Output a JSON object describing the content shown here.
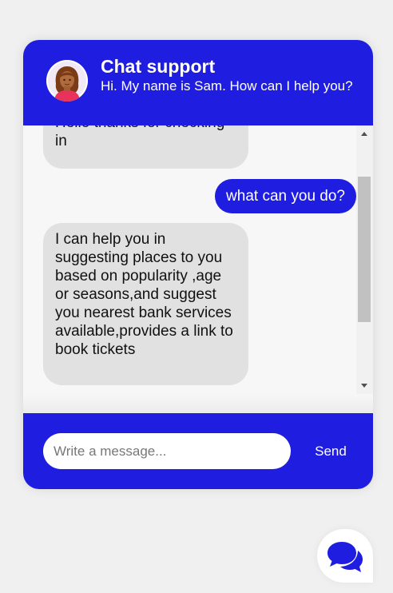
{
  "header": {
    "title": "Chat support",
    "subtitle": "Hi. My name is Sam. How can I help you?",
    "avatar_icon": "female-agent-avatar"
  },
  "messages": [
    {
      "sender": "bot",
      "text": "Hello thanks for checking in"
    },
    {
      "sender": "user",
      "text": "what can you do?"
    },
    {
      "sender": "bot",
      "text": "I can help you in suggesting places to you based on popularity ,age or seasons,and suggest you nearest bank services available,provides a link to book tickets"
    }
  ],
  "composer": {
    "placeholder": "Write a message...",
    "value": "",
    "send_label": "Send"
  },
  "launcher": {
    "icon": "chat-bubbles-icon"
  },
  "colors": {
    "accent": "#1e1de0",
    "bot_bubble": "#e1e1e1",
    "background": "#f0f0f0"
  }
}
